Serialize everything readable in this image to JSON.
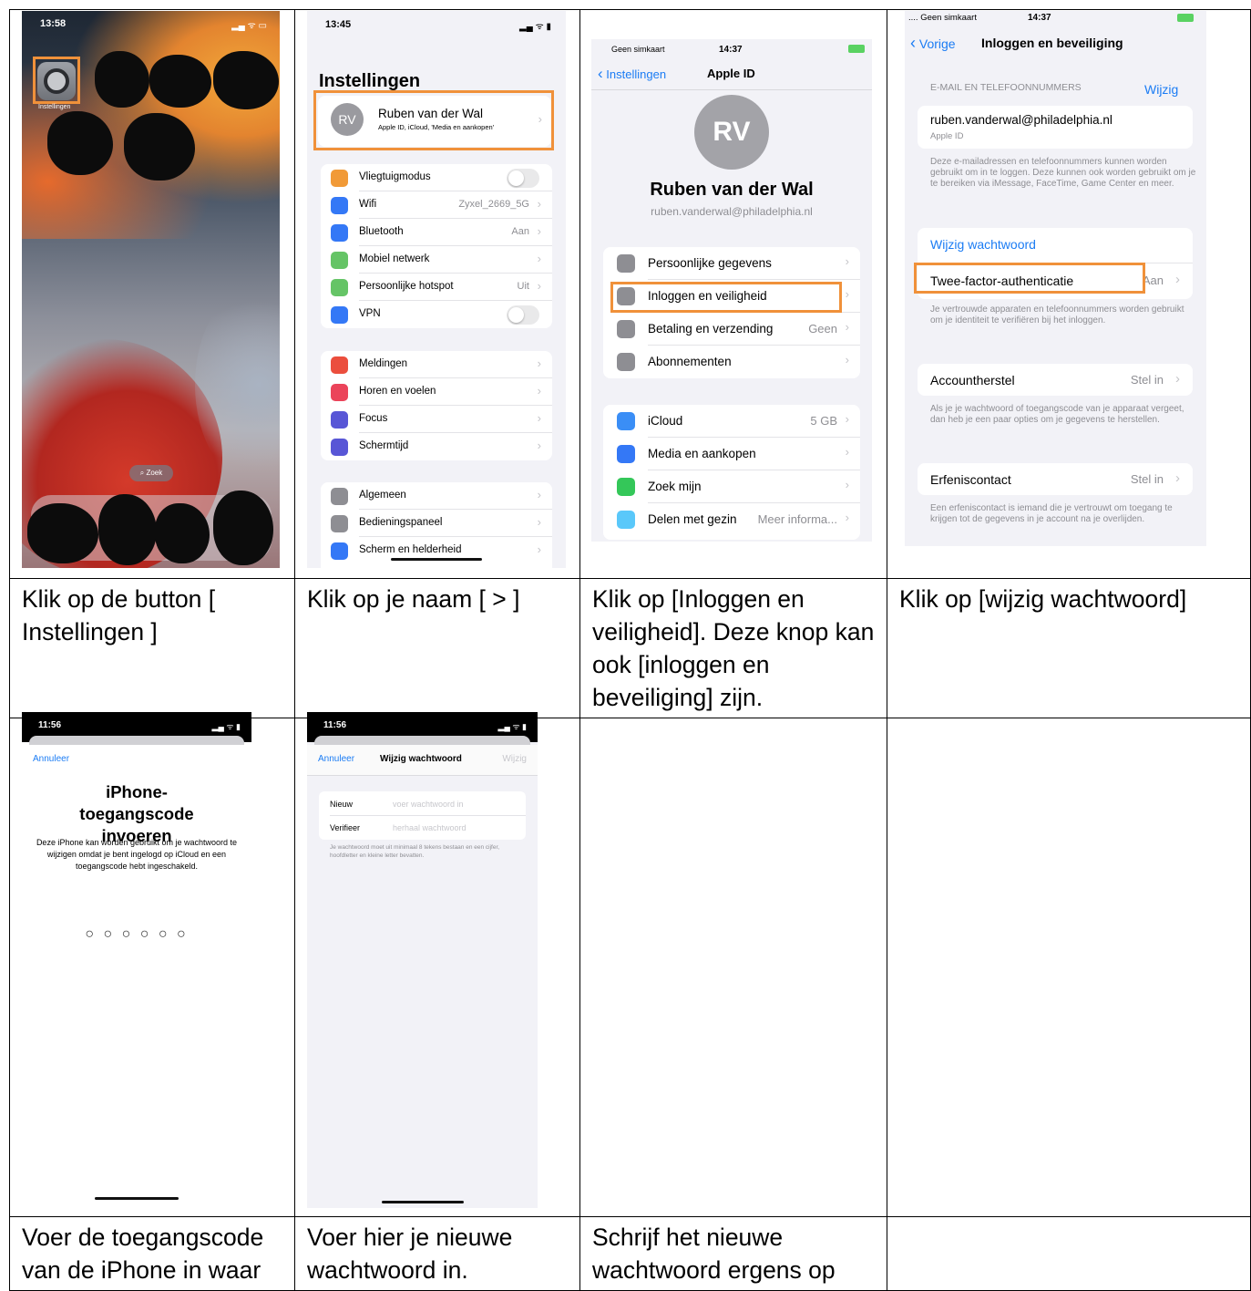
{
  "captions": {
    "c1": "Klik op de button [ Instellingen ]",
    "c2": "Klik op je naam [ > ]",
    "c3": "Klik op [Inloggen en veiligheid]. Deze knop kan ook [inloggen en beveiliging] zijn.",
    "c4": "Klik op [wijzig wachtwoord]",
    "c5": "Voer de toegangscode van de iPhone in waar",
    "c6": "Voer hier je nieuwe wachtwoord in.",
    "c7": "Schrijf het nieuwe wachtwoord ergens op",
    "c8": ""
  },
  "shot1": {
    "time": "13:58",
    "app_label": "Instellingen",
    "search": "Zoek"
  },
  "shot2": {
    "time": "13:45",
    "title": "Instellingen",
    "avatar": "RV",
    "name": "Ruben van der Wal",
    "subtitle": "Apple ID, iCloud, 'Media en aankopen'",
    "group1": [
      {
        "label": "Vliegtuigmodus",
        "value": "",
        "icon": "airplane-icon",
        "color": "#f19a37",
        "toggle": true
      },
      {
        "label": "Wifi",
        "value": "Zyxel_2669_5G",
        "icon": "wifi-icon",
        "color": "#3478f6"
      },
      {
        "label": "Bluetooth",
        "value": "Aan",
        "icon": "bluetooth-icon",
        "color": "#3478f6"
      },
      {
        "label": "Mobiel netwerk",
        "value": "",
        "icon": "antenna-icon",
        "color": "#65c466"
      },
      {
        "label": "Persoonlijke hotspot",
        "value": "Uit",
        "icon": "hotspot-icon",
        "color": "#65c466"
      },
      {
        "label": "VPN",
        "value": "",
        "icon": "vpn-icon",
        "color": "#3478f6",
        "toggle": true
      }
    ],
    "group2": [
      {
        "label": "Meldingen",
        "icon": "bell-icon",
        "color": "#eb4e3d"
      },
      {
        "label": "Horen en voelen",
        "icon": "speaker-icon",
        "color": "#eb445a"
      },
      {
        "label": "Focus",
        "icon": "moon-icon",
        "color": "#5856d6"
      },
      {
        "label": "Schermtijd",
        "icon": "hourglass-icon",
        "color": "#5856d6"
      }
    ],
    "group3": [
      {
        "label": "Algemeen",
        "icon": "gear-icon",
        "color": "#8e8e93"
      },
      {
        "label": "Bedieningspaneel",
        "icon": "switches-icon",
        "color": "#8e8e93"
      },
      {
        "label": "Scherm en helderheid",
        "icon": "brightness-icon",
        "color": "#3478f6"
      }
    ]
  },
  "shot3": {
    "carrier": "Geen simkaart",
    "time": "14:37",
    "back": "Instellingen",
    "title": "Apple ID",
    "avatar": "RV",
    "name": "Ruben van der Wal",
    "email": "ruben.vanderwal@philadelphia.nl",
    "group1": [
      {
        "label": "Persoonlijke gegevens",
        "value": "",
        "icon": "id-card-icon",
        "color": "#8e8e93"
      },
      {
        "label": "Inloggen en veiligheid",
        "value": "",
        "icon": "shield-icon",
        "color": "#8e8e93"
      },
      {
        "label": "Betaling en verzending",
        "value": "Geen",
        "icon": "credit-card-icon",
        "color": "#8e8e93"
      },
      {
        "label": "Abonnementen",
        "value": "",
        "icon": "plus-circle-icon",
        "color": "#8e8e93"
      }
    ],
    "group2": [
      {
        "label": "iCloud",
        "value": "5 GB",
        "icon": "cloud-icon",
        "color": "#3a8ef6"
      },
      {
        "label": "Media en aankopen",
        "value": "",
        "icon": "appstore-icon",
        "color": "#3478f6"
      },
      {
        "label": "Zoek mijn",
        "value": "",
        "icon": "findmy-icon",
        "color": "#34c759"
      },
      {
        "label": "Delen met gezin",
        "value": "Meer informa...",
        "icon": "family-icon",
        "color": "#5ac8fa"
      }
    ]
  },
  "shot4": {
    "carrier": ".... Geen simkaart",
    "time": "14:37",
    "back": "Vorige",
    "title": "Inloggen en beveiliging",
    "section": "E-MAIL EN TELEFOONNUMMERS",
    "edit": "Wijzig",
    "email": "ruben.vanderwal@philadelphia.nl",
    "email_sub": "Apple ID",
    "email_note": "Deze e-mailadressen en telefoonnummers kunnen worden gebruikt om in te loggen. Deze kunnen ook worden gebruikt om je te bereiken via iMessage, FaceTime, Game Center en meer.",
    "change_pw": "Wijzig wachtwoord",
    "tfa": "Twee-factor-authenticatie",
    "tfa_value": "Aan",
    "tfa_note": "Je vertrouwde apparaten en telefoonnummers worden gebruikt om je identiteit te verifiëren bij het inloggen.",
    "recovery": "Accountherstel",
    "recovery_value": "Stel in",
    "recovery_note": "Als je je wachtwoord of toegangscode van je apparaat vergeet, dan heb je een paar opties om je gegevens te herstellen.",
    "legacy": "Erfeniscontact",
    "legacy_value": "Stel in",
    "legacy_note": "Een erfeniscontact is iemand die je vertrouwt om toegang te krijgen tot de gegevens in je account na je overlijden."
  },
  "shot5": {
    "time": "11:56",
    "cancel": "Annuleer",
    "title": "iPhone-toegangscode invoeren",
    "body": "Deze iPhone kan worden gebruikt om je wachtwoord te wijzigen omdat je bent ingelogd op iCloud en een toegangscode hebt ingeschakeld.",
    "dots": "○ ○ ○ ○ ○ ○"
  },
  "shot6": {
    "time": "11:56",
    "cancel": "Annuleer",
    "title": "Wijzig wachtwoord",
    "done": "Wijzig",
    "new_label": "Nieuw",
    "new_placeholder": "voer wachtwoord in",
    "verify_label": "Verifieer",
    "verify_placeholder": "herhaal wachtwoord",
    "note": "Je wachtwoord moet uit minimaal 8 tekens bestaan en een cijfer, hoofdletter en kleine letter bevatten."
  }
}
